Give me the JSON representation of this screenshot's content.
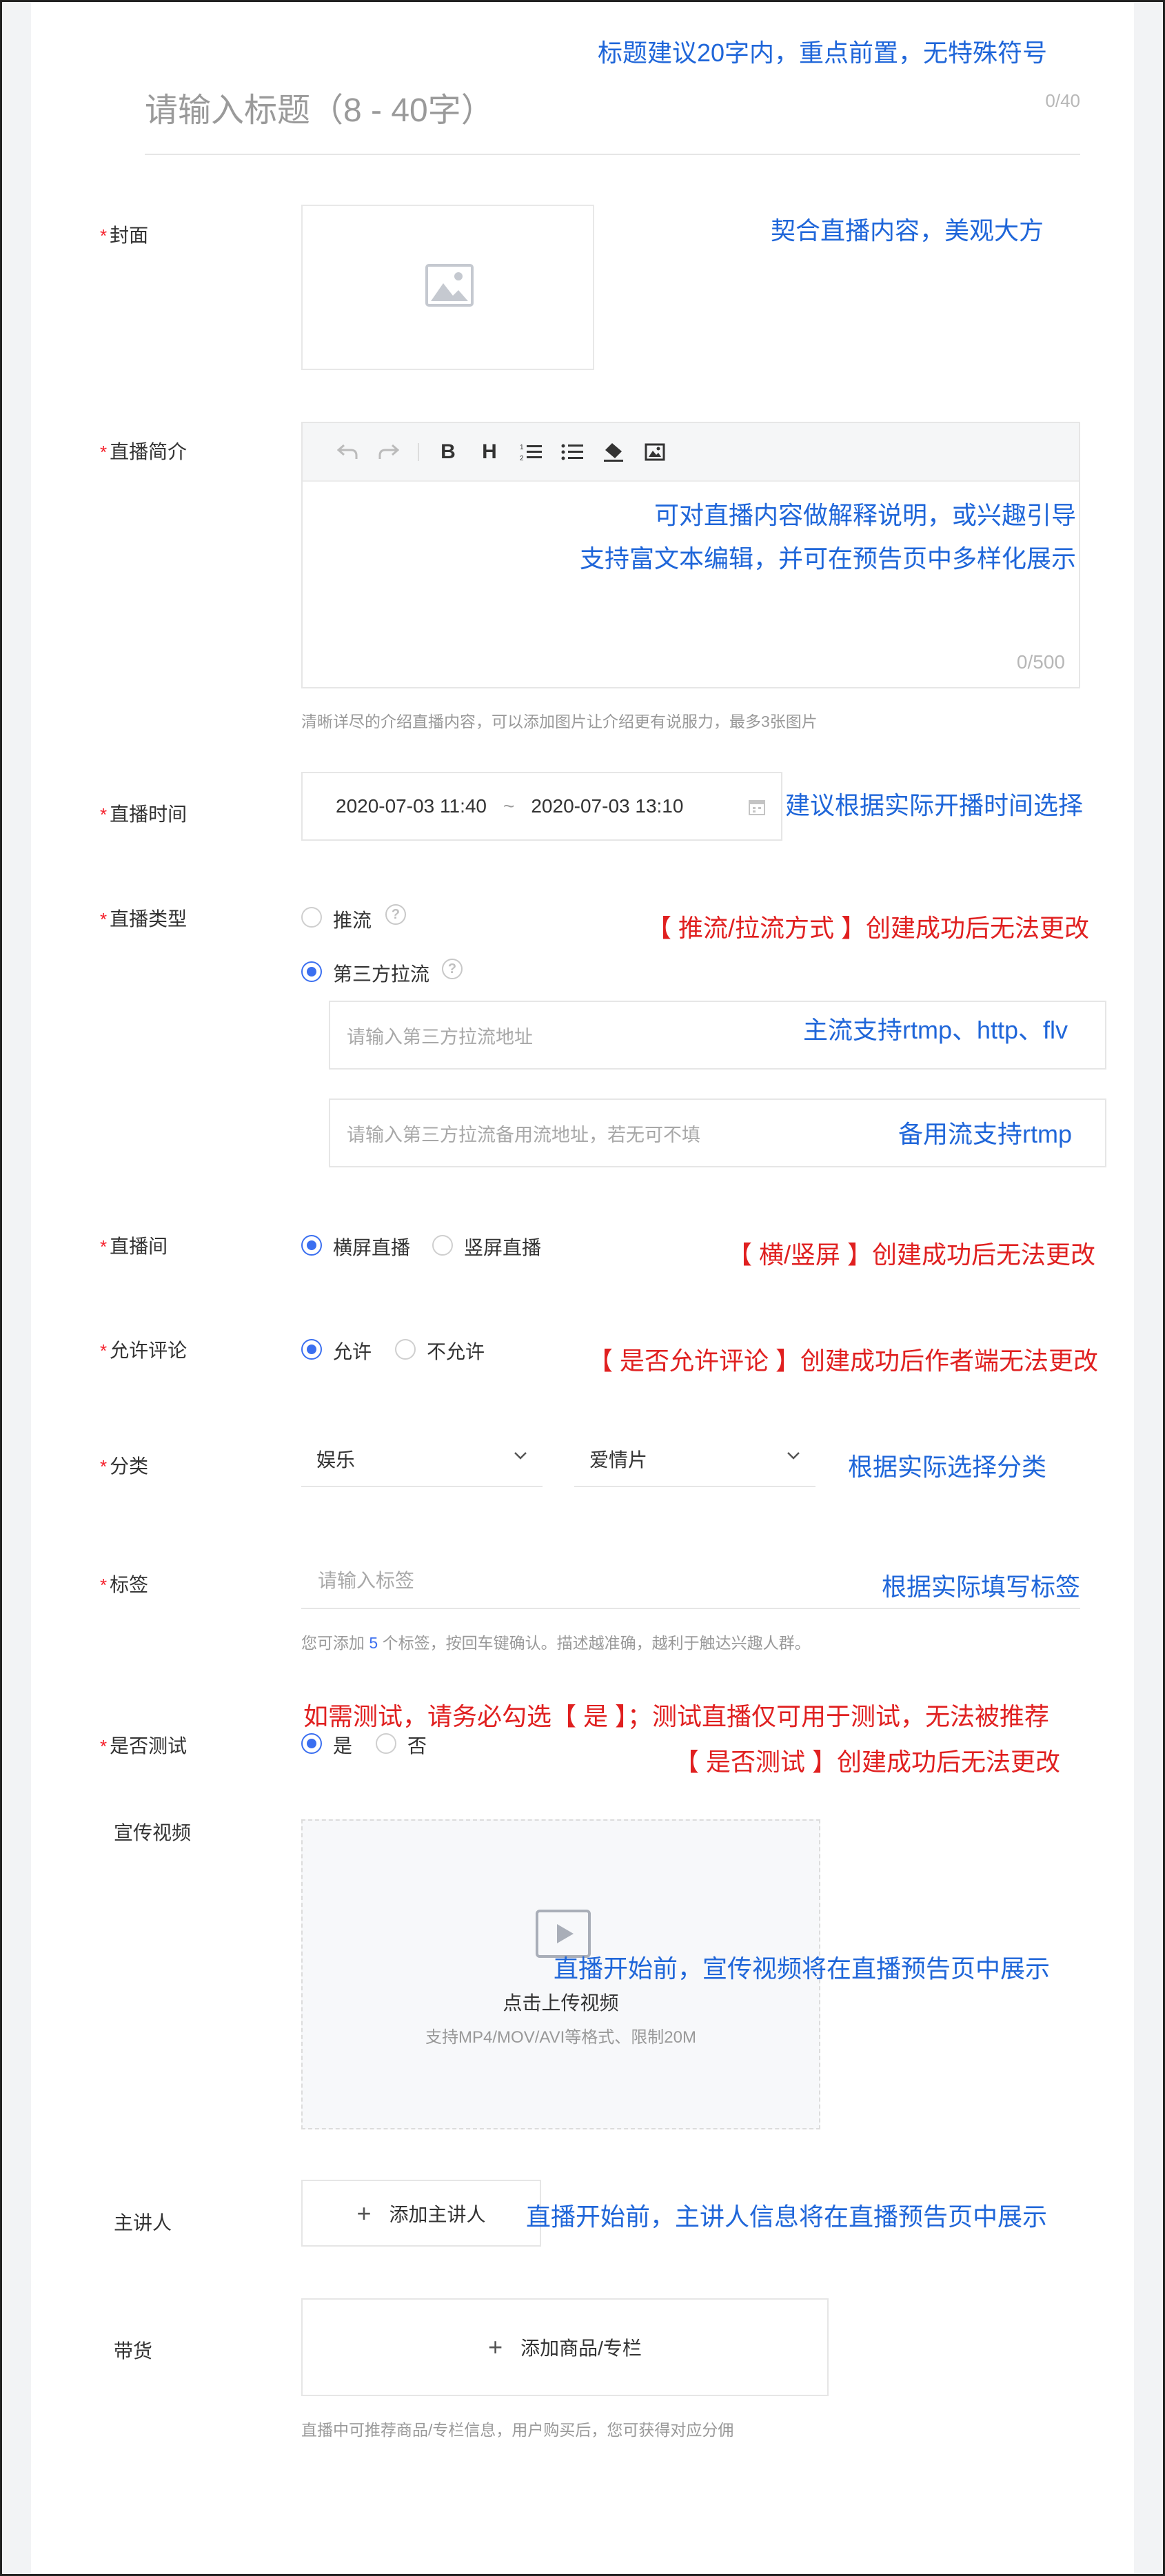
{
  "title": {
    "placeholder": "请输入标题（8 - 40字）",
    "count": "0/40",
    "note": "标题建议20字内，重点前置，无特殊符号"
  },
  "cover": {
    "label": "封面",
    "note": "契合直播内容，美观大方",
    "icon": "image-placeholder-icon"
  },
  "intro": {
    "label": "直播简介",
    "toolbar": [
      "undo-icon",
      "redo-icon",
      "bold-icon",
      "heading-icon",
      "ordered-list-icon",
      "bullet-list-icon",
      "eraser-icon",
      "image-icon"
    ],
    "bold": "B",
    "heading": "H",
    "note1": "可对直播内容做解释说明，或兴趣引导",
    "note2": "支持富文本编辑，并可在预告页中多样化展示",
    "count": "0/500",
    "hint": "清晰详尽的介绍直播内容，可以添加图片让介绍更有说服力，最多3张图片"
  },
  "time": {
    "label": "直播时间",
    "start": "2020-07-03 11:40",
    "sep": "~",
    "end": "2020-07-03 13:10",
    "note": "建议根据实际开播时间选择"
  },
  "type": {
    "label": "直播类型",
    "option1": "推流",
    "option2": "第三方拉流",
    "note": "【 推流/拉流方式 】创建成功后无法更改",
    "main_placeholder": "请输入第三方拉流地址",
    "main_note": "主流支持rtmp、http、flv",
    "backup_placeholder": "请输入第三方拉流备用流地址，若无可不填",
    "backup_note": "备用流支持rtmp"
  },
  "room": {
    "label": "直播间",
    "option1": "横屏直播",
    "option2": "竖屏直播",
    "note": "【 横/竖屏 】创建成功后无法更改"
  },
  "comment": {
    "label": "允许评论",
    "option1": "允许",
    "option2": "不允许",
    "note": "【 是否允许评论 】创建成功后作者端无法更改"
  },
  "category": {
    "label": "分类",
    "value1": "娱乐",
    "value2": "爱情片",
    "note": "根据实际选择分类"
  },
  "tags": {
    "label": "标签",
    "placeholder": "请输入标签",
    "note": "根据实际填写标签",
    "hint_a": "您可添加",
    "hint_num": "5",
    "hint_b": "个标签，按回车键确认。描述越准确，越利于触达兴趣人群。"
  },
  "test": {
    "label": "是否测试",
    "option1": "是",
    "option2": "否",
    "note1": "如需测试，请务必勾选【 是 】；测试直播仅可用于测试，无法被推荐",
    "note2": "【 是否测试 】创建成功后无法更改"
  },
  "video": {
    "label": "宣传视频",
    "upload_text": "点击上传视频",
    "upload_hint": "支持MP4/MOV/AVI等格式、限制20M",
    "note": "直播开始前，宣传视频将在直播预告页中展示"
  },
  "speaker": {
    "label": "主讲人",
    "button": "添加主讲人",
    "note": "直播开始前，主讲人信息将在直播预告页中展示"
  },
  "goods": {
    "label": "带货",
    "button": "添加商品/专栏",
    "hint": "直播中可推荐商品/专栏信息，用户购买后，您可获得对应分佣"
  },
  "colors": {
    "note_blue": "#1f66d9",
    "note_red": "#e02020",
    "radio_active": "#3b6ff0",
    "required_star": "#f5222d"
  }
}
